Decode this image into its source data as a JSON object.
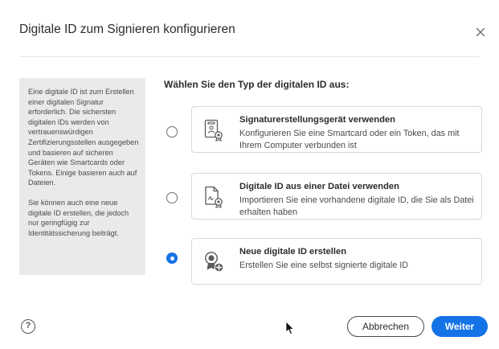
{
  "dialog": {
    "title": "Digitale ID zum Signieren konfigurieren",
    "close_icon": "close-icon"
  },
  "info": {
    "paragraph1": "Eine digitale ID ist zum Erstellen einer digitalen Signatur erforderlich. Die sichersten digitalen IDs werden von vertrauenswürdigen Zertifizierungsstellen ausgegeben und basieren auf sicheren Geräten wie Smartcards oder Tokens. Einige basieren auch auf Dateien.",
    "paragraph2": "Sie können auch eine neue digitale ID erstellen, die jedoch nur geringfügig zur Identitätssicherung beiträgt."
  },
  "question": "Wählen Sie den Typ der digitalen ID aus:",
  "options": [
    {
      "title": "Signaturerstellungsgerät verwenden",
      "description": "Konfigurieren Sie eine Smartcard oder ein Token, das mit Ihrem Computer verbunden ist",
      "icon": "smartcard-id-icon",
      "selected": false
    },
    {
      "title": "Digitale ID aus einer Datei verwenden",
      "description": "Importieren Sie eine vorhandene digitale ID, die Sie als Datei erhalten haben",
      "icon": "file-id-icon",
      "selected": false
    },
    {
      "title": "Neue digitale ID erstellen",
      "description": "Erstellen Sie eine selbst signierte digitale ID",
      "icon": "new-id-badge-icon",
      "selected": true
    }
  ],
  "footer": {
    "help_glyph": "?",
    "cancel_label": "Abbrechen",
    "next_label": "Weiter"
  },
  "colors": {
    "accent": "#1473e6",
    "panel_bg": "#eaeaea",
    "border": "#d8d8d8"
  }
}
